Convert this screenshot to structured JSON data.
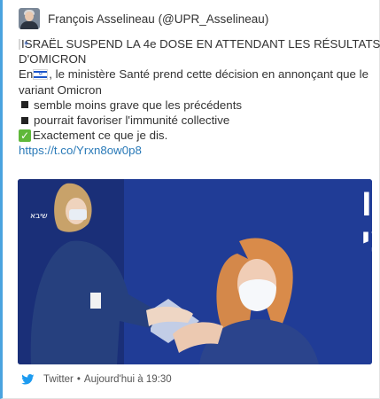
{
  "header": {
    "author": "François Asselineau (@UPR_Asselineau)"
  },
  "tweet": {
    "line1": "ISRAËL SUSPEND LA 4e DOSE EN ATTENDANT LES RÉSULTATS",
    "line2": "D'OMICRON",
    "line3_prefix": "En ",
    "line3_rest": ", le ministère Santé prend cette décision en annonçant que le",
    "line4": "variant Omicron",
    "bullet1": "semble moins grave que les précédents",
    "bullet2": "pourrait favoriser l'immunité collective",
    "check_line": "Exactement ce que je dis.",
    "link": "https://t.co/Yrxn8ow0p8"
  },
  "media": {
    "banner_line1": "עמדת חיסון",
    "banner_line2": "קורונה רביעי",
    "logo_small": "שיבא"
  },
  "footer": {
    "source": "Twitter",
    "separator": "•",
    "time": "Aujourd'hui à 19:30"
  },
  "colors": {
    "accent": "#4aa3df",
    "link": "#2a7ab8",
    "twitter_blue": "#1d9bf0",
    "banner_blue": "#203c96"
  },
  "icons": [
    "avatar",
    "israel-flag-icon",
    "black-square-icon",
    "check-mark-icon",
    "twitter-bird-icon"
  ]
}
